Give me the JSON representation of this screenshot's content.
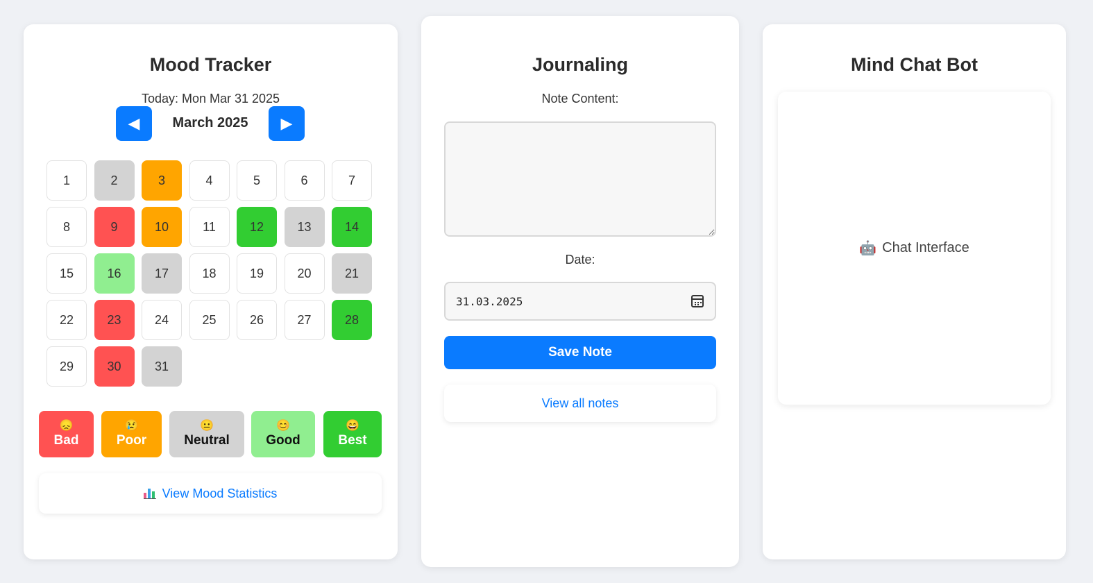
{
  "mood_tracker": {
    "title": "Mood Tracker",
    "today": "Today: Mon Mar 31 2025",
    "month": "March 2025",
    "prev_icon": "◀",
    "next_icon": "▶",
    "days": [
      {
        "day": "1",
        "mood": "none"
      },
      {
        "day": "2",
        "mood": "neutral"
      },
      {
        "day": "3",
        "mood": "poor"
      },
      {
        "day": "4",
        "mood": "none"
      },
      {
        "day": "5",
        "mood": "none"
      },
      {
        "day": "6",
        "mood": "none"
      },
      {
        "day": "7",
        "mood": "none"
      },
      {
        "day": "8",
        "mood": "none"
      },
      {
        "day": "9",
        "mood": "bad"
      },
      {
        "day": "10",
        "mood": "poor"
      },
      {
        "day": "11",
        "mood": "none"
      },
      {
        "day": "12",
        "mood": "best"
      },
      {
        "day": "13",
        "mood": "neutral"
      },
      {
        "day": "14",
        "mood": "best"
      },
      {
        "day": "15",
        "mood": "none"
      },
      {
        "day": "16",
        "mood": "good"
      },
      {
        "day": "17",
        "mood": "neutral"
      },
      {
        "day": "18",
        "mood": "none"
      },
      {
        "day": "19",
        "mood": "none"
      },
      {
        "day": "20",
        "mood": "none"
      },
      {
        "day": "21",
        "mood": "neutral"
      },
      {
        "day": "22",
        "mood": "none"
      },
      {
        "day": "23",
        "mood": "bad"
      },
      {
        "day": "24",
        "mood": "none"
      },
      {
        "day": "25",
        "mood": "none"
      },
      {
        "day": "26",
        "mood": "none"
      },
      {
        "day": "27",
        "mood": "none"
      },
      {
        "day": "28",
        "mood": "best"
      },
      {
        "day": "29",
        "mood": "none"
      },
      {
        "day": "30",
        "mood": "bad"
      },
      {
        "day": "31",
        "mood": "neutral"
      }
    ],
    "mood_buttons": [
      {
        "id": "bad",
        "label": "Bad",
        "emoji": "😞",
        "color": "#ff5252"
      },
      {
        "id": "poor",
        "label": "Poor",
        "emoji": "😢",
        "color": "#ffa500"
      },
      {
        "id": "neutral",
        "label": "Neutral",
        "emoji": "😐",
        "color": "#d3d3d3"
      },
      {
        "id": "good",
        "label": "Good",
        "emoji": "😊",
        "color": "#90ee90"
      },
      {
        "id": "best",
        "label": "Best",
        "emoji": "😄",
        "color": "#32cd32"
      }
    ],
    "stats_link": "View Mood Statistics",
    "stats_icon": "bar-chart-icon"
  },
  "journaling": {
    "title": "Journaling",
    "note_label": "Note Content:",
    "note_value": "",
    "date_label": "Date:",
    "date_value": "31.03.2025",
    "save_label": "Save Note",
    "view_notes_label": "View all notes"
  },
  "chat": {
    "title": "Mind Chat Bot",
    "robot_icon": "🤖",
    "interface_label": "Chat Interface"
  },
  "colors": {
    "accent": "#0a7bff",
    "background": "#eff1f5",
    "bad": "#ff5252",
    "poor": "#ffa500",
    "neutral": "#d3d3d3",
    "good": "#90ee90",
    "best": "#32cd32"
  }
}
